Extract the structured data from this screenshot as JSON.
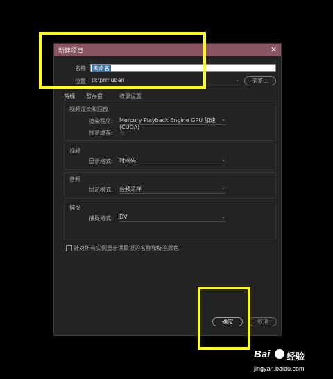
{
  "dialog": {
    "title": "新建项目",
    "close_glyph": "✕",
    "name_label": "名称:",
    "name_value": "未命名",
    "location_label": "位置:",
    "location_value": "D:\\prmuban",
    "browse_label": "浏览...",
    "tabs": [
      {
        "label": "常规",
        "active": true
      },
      {
        "label": "暂存盘",
        "active": false
      },
      {
        "label": "收录设置",
        "active": false
      }
    ],
    "sections": {
      "video_render": {
        "title": "视频渲染和回放",
        "renderer_label": "渲染程序:",
        "renderer_value": "Mercury Playback Engine GPU 加速 (CUDA)",
        "preview_cache_label": "预览缓存:",
        "preview_cache_value": "无"
      },
      "video": {
        "title": "视频",
        "display_format_label": "显示格式:",
        "display_format_value": "时间码"
      },
      "audio": {
        "title": "音频",
        "display_format_label": "显示格式:",
        "display_format_value": "音频采样"
      },
      "capture": {
        "title": "捕捉",
        "format_label": "捕捉格式:",
        "format_value": "DV"
      }
    },
    "checkbox_label": "针对所有实例显示项目项的名称和标签颜色",
    "ok_label": "确定",
    "cancel_label": "取消"
  },
  "colors": {
    "titlebar": "#8b5563",
    "dialog_bg": "#232323",
    "highlight": "#ffff1a",
    "selection": "#3f6d9d"
  },
  "watermark": {
    "brand": "Bai",
    "brand_suffix": "经验",
    "url": "jingyan.baidu.com"
  }
}
